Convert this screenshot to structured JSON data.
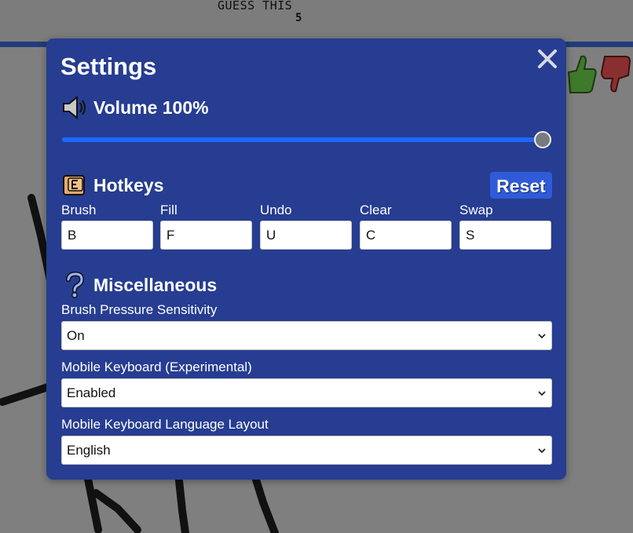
{
  "game": {
    "guess_label": "GUESS THIS",
    "letter_count": "5",
    "word_hint": "_ _ _ _ _"
  },
  "settings": {
    "title": "Settings",
    "volume": {
      "label": "Volume 100%",
      "value_percent": 100
    },
    "hotkeys": {
      "title": "Hotkeys",
      "reset_label": "Reset",
      "items": [
        {
          "label": "Brush",
          "value": "B"
        },
        {
          "label": "Fill",
          "value": "F"
        },
        {
          "label": "Undo",
          "value": "U"
        },
        {
          "label": "Clear",
          "value": "C"
        },
        {
          "label": "Swap",
          "value": "S"
        }
      ]
    },
    "misc": {
      "title": "Miscellaneous",
      "options": [
        {
          "label": "Brush Pressure Sensitivity",
          "value": "On"
        },
        {
          "label": "Mobile Keyboard (Experimental)",
          "value": "Enabled"
        },
        {
          "label": "Mobile Keyboard Language Layout",
          "value": "English"
        }
      ]
    }
  },
  "colors": {
    "modal_bg": "#263d91",
    "slider_fill": "#1e67ff",
    "reset_button": "#2f5bd9",
    "thumbs_up": "#3f7a2a",
    "thumbs_down": "#8a2f2f"
  },
  "icons": {
    "close": "close-icon",
    "volume": "speaker-icon",
    "hotkeys": "keyboard-key-icon",
    "misc": "question-mark-icon",
    "vote_up": "thumbs-up-icon",
    "vote_down": "thumbs-down-icon",
    "select": "chevron-down-icon"
  }
}
